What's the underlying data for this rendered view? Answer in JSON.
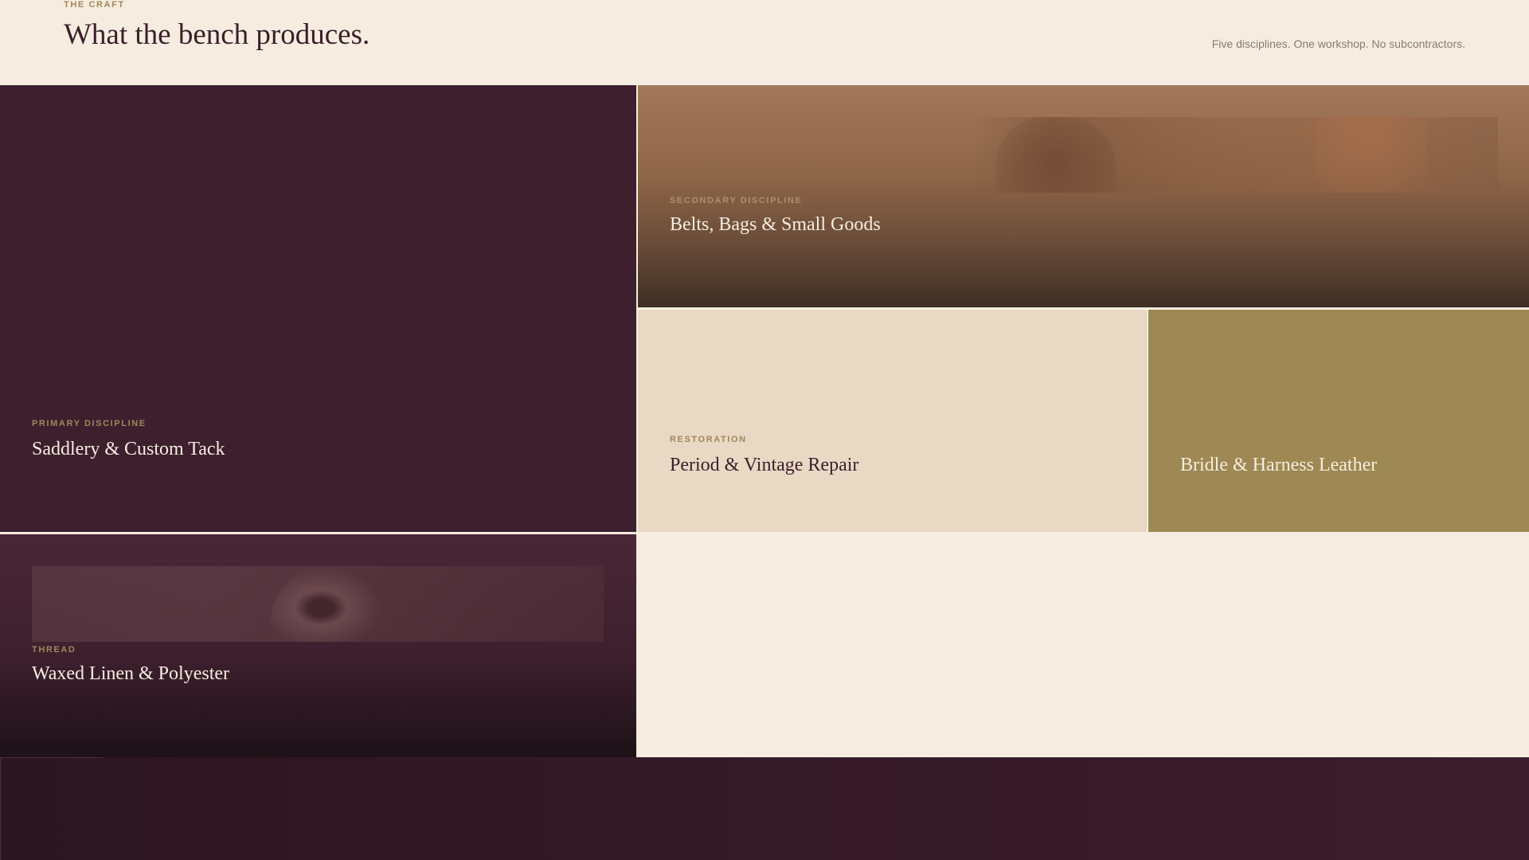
{
  "header": {
    "eyebrow": "THE CRAFT",
    "title": "What the bench produces.",
    "tagline": "Five disciplines. One workshop. No subcontractors."
  },
  "tiles": {
    "saddlery": {
      "label": "PRIMARY DISCIPLINE",
      "name": "Saddlery & Custom Tack"
    },
    "belts": {
      "label": "SECONDARY DISCIPLINE",
      "name": "Belts, Bags & Small Goods"
    },
    "restoration": {
      "label": "RESTORATION",
      "name": "Period & Vintage Repair"
    },
    "bridle": {
      "label": "",
      "name": "Bridle & Harness Leather"
    },
    "thread": {
      "label": "THREAD",
      "name": "Waxed Linen & Polyester"
    }
  },
  "colors": {
    "plum": "#3d1f2e",
    "cream": "#f6ede0",
    "sand": "#e9d8c4",
    "olive": "#9e8854",
    "brass": "#a2865a"
  }
}
